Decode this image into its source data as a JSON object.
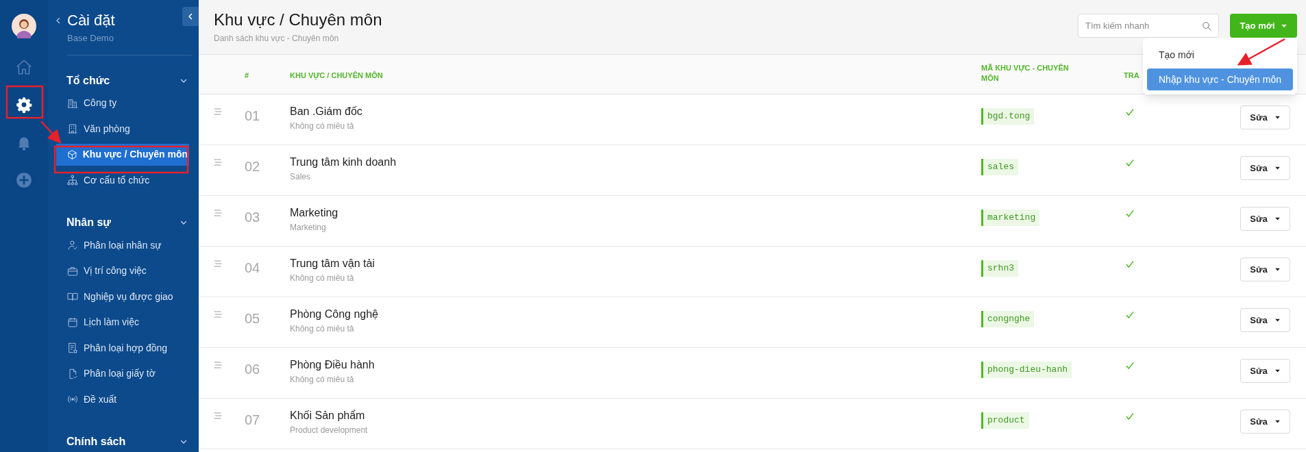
{
  "rail": {
    "items": [
      {
        "selected": false
      },
      {
        "selected": true
      },
      {
        "selected": false
      },
      {
        "selected": false
      }
    ]
  },
  "sidebar": {
    "title": "Cài đặt",
    "subtitle": "Base Demo",
    "sections": [
      {
        "title": "Tổ chức",
        "expanded": true,
        "items": [
          {
            "label": "Công ty",
            "selected": false
          },
          {
            "label": "Văn phòng",
            "selected": false
          },
          {
            "label": "Khu vực / Chuyên môn",
            "selected": true
          },
          {
            "label": "Cơ cấu tổ chức",
            "selected": false
          }
        ]
      },
      {
        "title": "Nhân sự",
        "expanded": true,
        "items": [
          {
            "label": "Phân loại nhân sự",
            "selected": false
          },
          {
            "label": "Vị trí công việc",
            "selected": false
          },
          {
            "label": "Nghiệp vụ được giao",
            "selected": false
          },
          {
            "label": "Lịch làm việc",
            "selected": false
          },
          {
            "label": "Phân loại hợp đồng",
            "selected": false
          },
          {
            "label": "Phân loại giấy tờ",
            "selected": false
          },
          {
            "label": "Đề xuất",
            "selected": false
          }
        ]
      },
      {
        "title": "Chính sách",
        "expanded": true
      }
    ]
  },
  "header": {
    "title": "Khu vực / Chuyên môn",
    "subtitle": "Danh sách khu vực - Chuyên môn",
    "search": {
      "placeholder": "Tìm kiếm nhanh"
    },
    "create_button": "Tạo mới"
  },
  "dropdown": {
    "items": [
      {
        "label": "Tạo mới",
        "selected": false
      },
      {
        "label": "Nhập khu vực - Chuyên môn",
        "selected": true
      }
    ]
  },
  "table": {
    "columns": [
      "#",
      "KHU VỰC / CHUYÊN MÔN",
      "MÃ KHU VỰC - CHUYÊN MÔN",
      "TRA"
    ],
    "rows": [
      {
        "number": "01",
        "name": "Ban .Giám đốc",
        "description": "Không có miêu tả",
        "code": "bgd.tong",
        "active": true,
        "action": "Sửa"
      },
      {
        "number": "02",
        "name": "Trung tâm kinh doanh",
        "description": "Sales",
        "code": "sales",
        "active": true,
        "action": "Sửa"
      },
      {
        "number": "03",
        "name": "Marketing",
        "description": "Marketing",
        "code": "marketing",
        "active": true,
        "action": "Sửa"
      },
      {
        "number": "04",
        "name": "Trung tâm vận tải",
        "description": "Không có miêu tả",
        "code": "srhn3",
        "active": true,
        "action": "Sửa"
      },
      {
        "number": "05",
        "name": "Phòng Công nghệ",
        "description": "Không có miêu tả",
        "code": "congnghe",
        "active": true,
        "action": "Sửa"
      },
      {
        "number": "06",
        "name": "Phòng Điều hành",
        "description": "Không có miêu tả",
        "code": "phong-dieu-hanh",
        "active": true,
        "action": "Sửa"
      },
      {
        "number": "07",
        "name": "Khối Sản phẩm",
        "description": "Product development",
        "code": "product",
        "active": true,
        "action": "Sửa"
      }
    ]
  }
}
